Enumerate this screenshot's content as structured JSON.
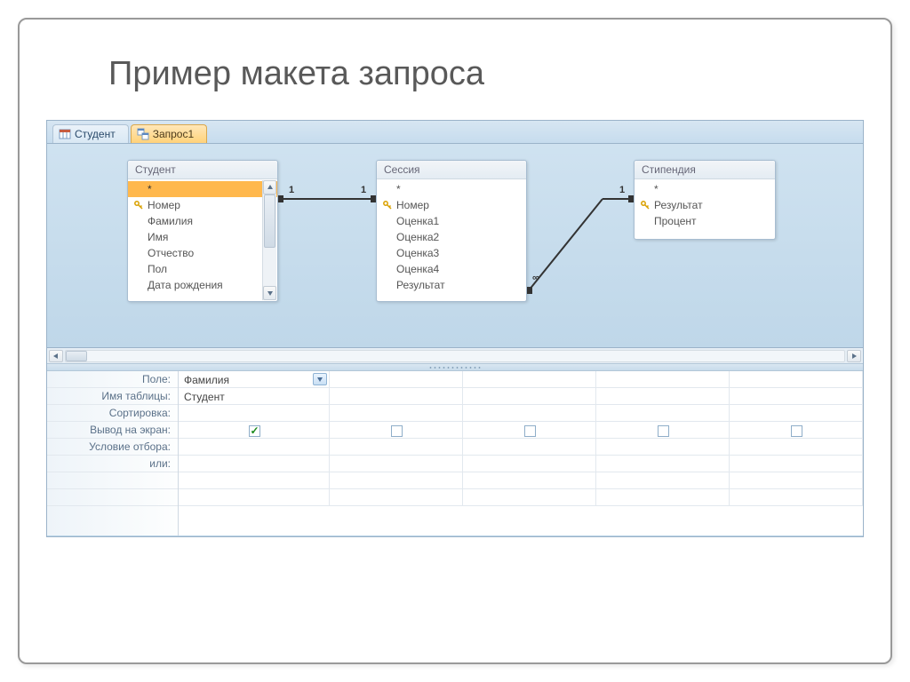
{
  "slide_title": "Пример макета запроса",
  "tabs": [
    {
      "label": "Студент",
      "active": false
    },
    {
      "label": "Запрос1",
      "active": true
    }
  ],
  "tables": {
    "student": {
      "title": "Студент",
      "fields": [
        "*",
        "Номер",
        "Фамилия",
        "Имя",
        "Отчество",
        "Пол",
        "Дата рождения"
      ]
    },
    "session": {
      "title": "Сессия",
      "fields": [
        "*",
        "Номер",
        "Оценка1",
        "Оценка2",
        "Оценка3",
        "Оценка4",
        "Результат"
      ]
    },
    "stipend": {
      "title": "Стипендия",
      "fields": [
        "*",
        "Результат",
        "Процент"
      ]
    }
  },
  "relations": {
    "r1_left": "1",
    "r1_right": "1",
    "r2_left": "∞",
    "r2_right": "1"
  },
  "grid": {
    "labels": [
      "Поле:",
      "Имя таблицы:",
      "Сортировка:",
      "Вывод на экран:",
      "Условие отбора:",
      "или:"
    ],
    "col1": {
      "field": "Фамилия",
      "table": "Студент"
    }
  }
}
